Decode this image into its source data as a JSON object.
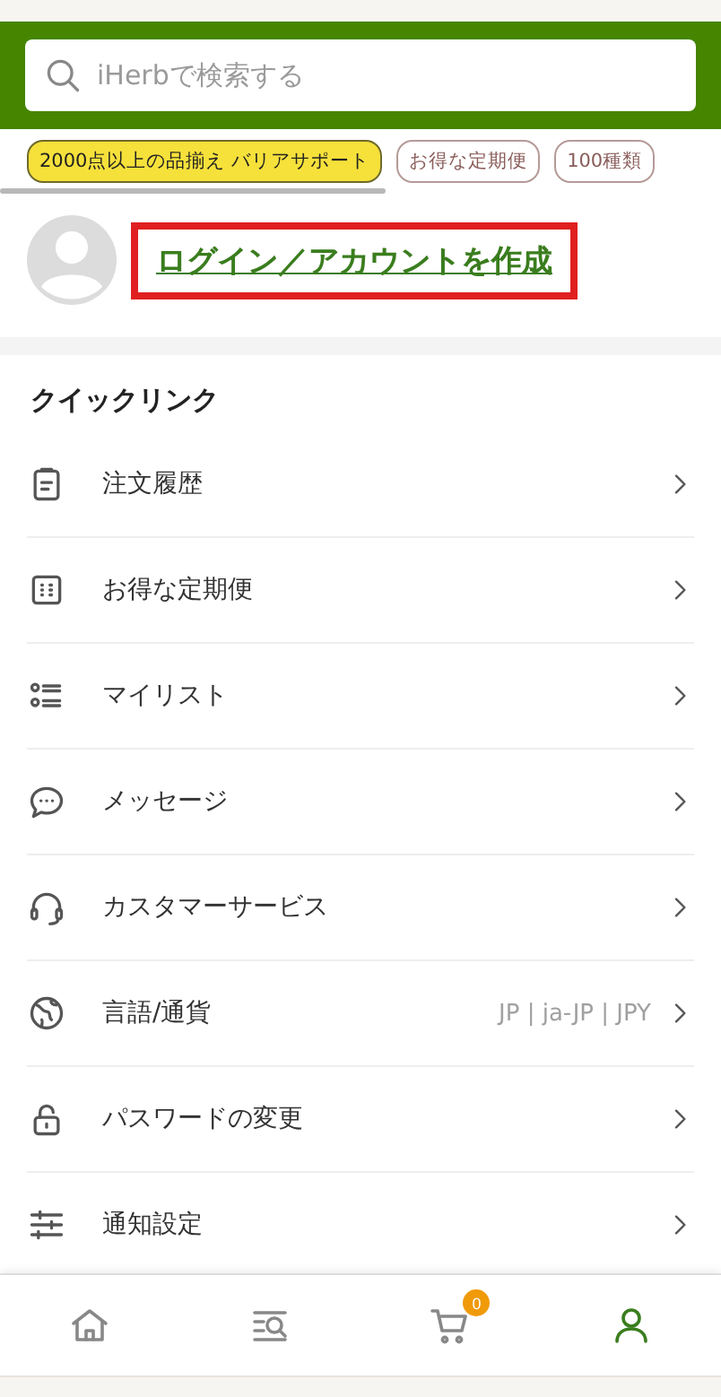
{
  "search": {
    "placeholder": "iHerbで検索する"
  },
  "chips": [
    {
      "label": "2000点以上の品揃え バリアサポート",
      "selected": true
    },
    {
      "label": "お得な定期便",
      "selected": false
    },
    {
      "label": "100種類",
      "selected": false
    }
  ],
  "account": {
    "link": "ログイン／アカウントを作成",
    "highlighted": true
  },
  "quick_links": {
    "title": "クイックリンク",
    "items": [
      {
        "label": "注文履歴"
      },
      {
        "label": "お得な定期便"
      },
      {
        "label": "マイリスト"
      },
      {
        "label": "メッセージ"
      },
      {
        "label": "カスタマーサービス"
      },
      {
        "label": "言語/通貨",
        "value": "JP | ja-JP | JPY"
      },
      {
        "label": "パスワードの変更"
      },
      {
        "label": "通知設定"
      }
    ]
  },
  "bottom_nav": [
    {
      "selected": false
    },
    {
      "selected": false
    },
    {
      "selected": false,
      "badge": "0"
    },
    {
      "selected": true
    }
  ]
}
